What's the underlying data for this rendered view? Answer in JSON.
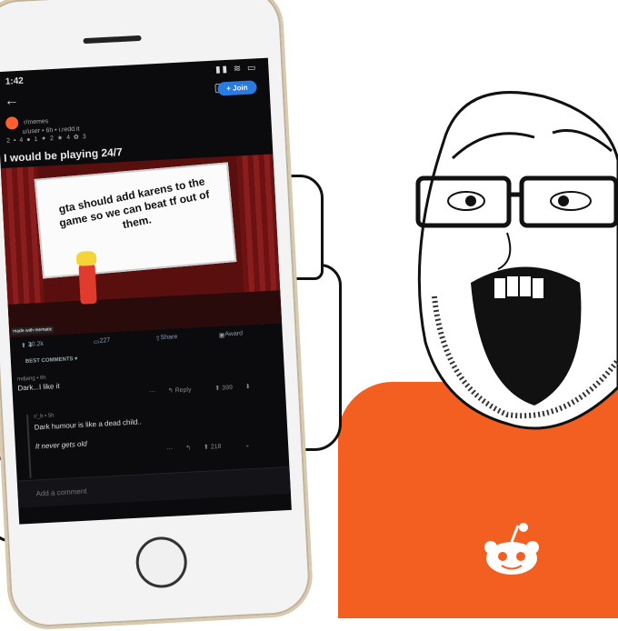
{
  "status": {
    "time": "1:42",
    "icons": "▮▮ ≋ ▭"
  },
  "nav": {
    "back": "←",
    "icons": "▢ ⋯"
  },
  "post": {
    "join_label": "+ Join",
    "subreddit": "r/memes",
    "meta": "u/user • 6h • i.redd.it",
    "awards": "2 ▪ 4 ● 1 ✦ 2 ★ 4 ✿ 3",
    "title": "I would be playing 24/7",
    "meme_text": "gta should add karens to the game so we can beat tf out of them.",
    "watermark": "made with mematic"
  },
  "actions": {
    "upvotes": "20.2k",
    "comments": "227",
    "share": "Share",
    "award": "Award"
  },
  "sort": "BEST COMMENTS ▾",
  "comments": [
    {
      "user": "mdjang • 6h",
      "text": "Dark...I like it",
      "reply": "Reply",
      "votes": "399"
    },
    {
      "user": "r/_b • 5h",
      "text": "Dark humour is like a dead child..",
      "text2": "It never gets old",
      "votes": "218"
    }
  ],
  "add_comment_placeholder": "Add a comment",
  "colors": {
    "reddit_orange": "#f35f21",
    "join_blue": "#2a7ae2"
  }
}
